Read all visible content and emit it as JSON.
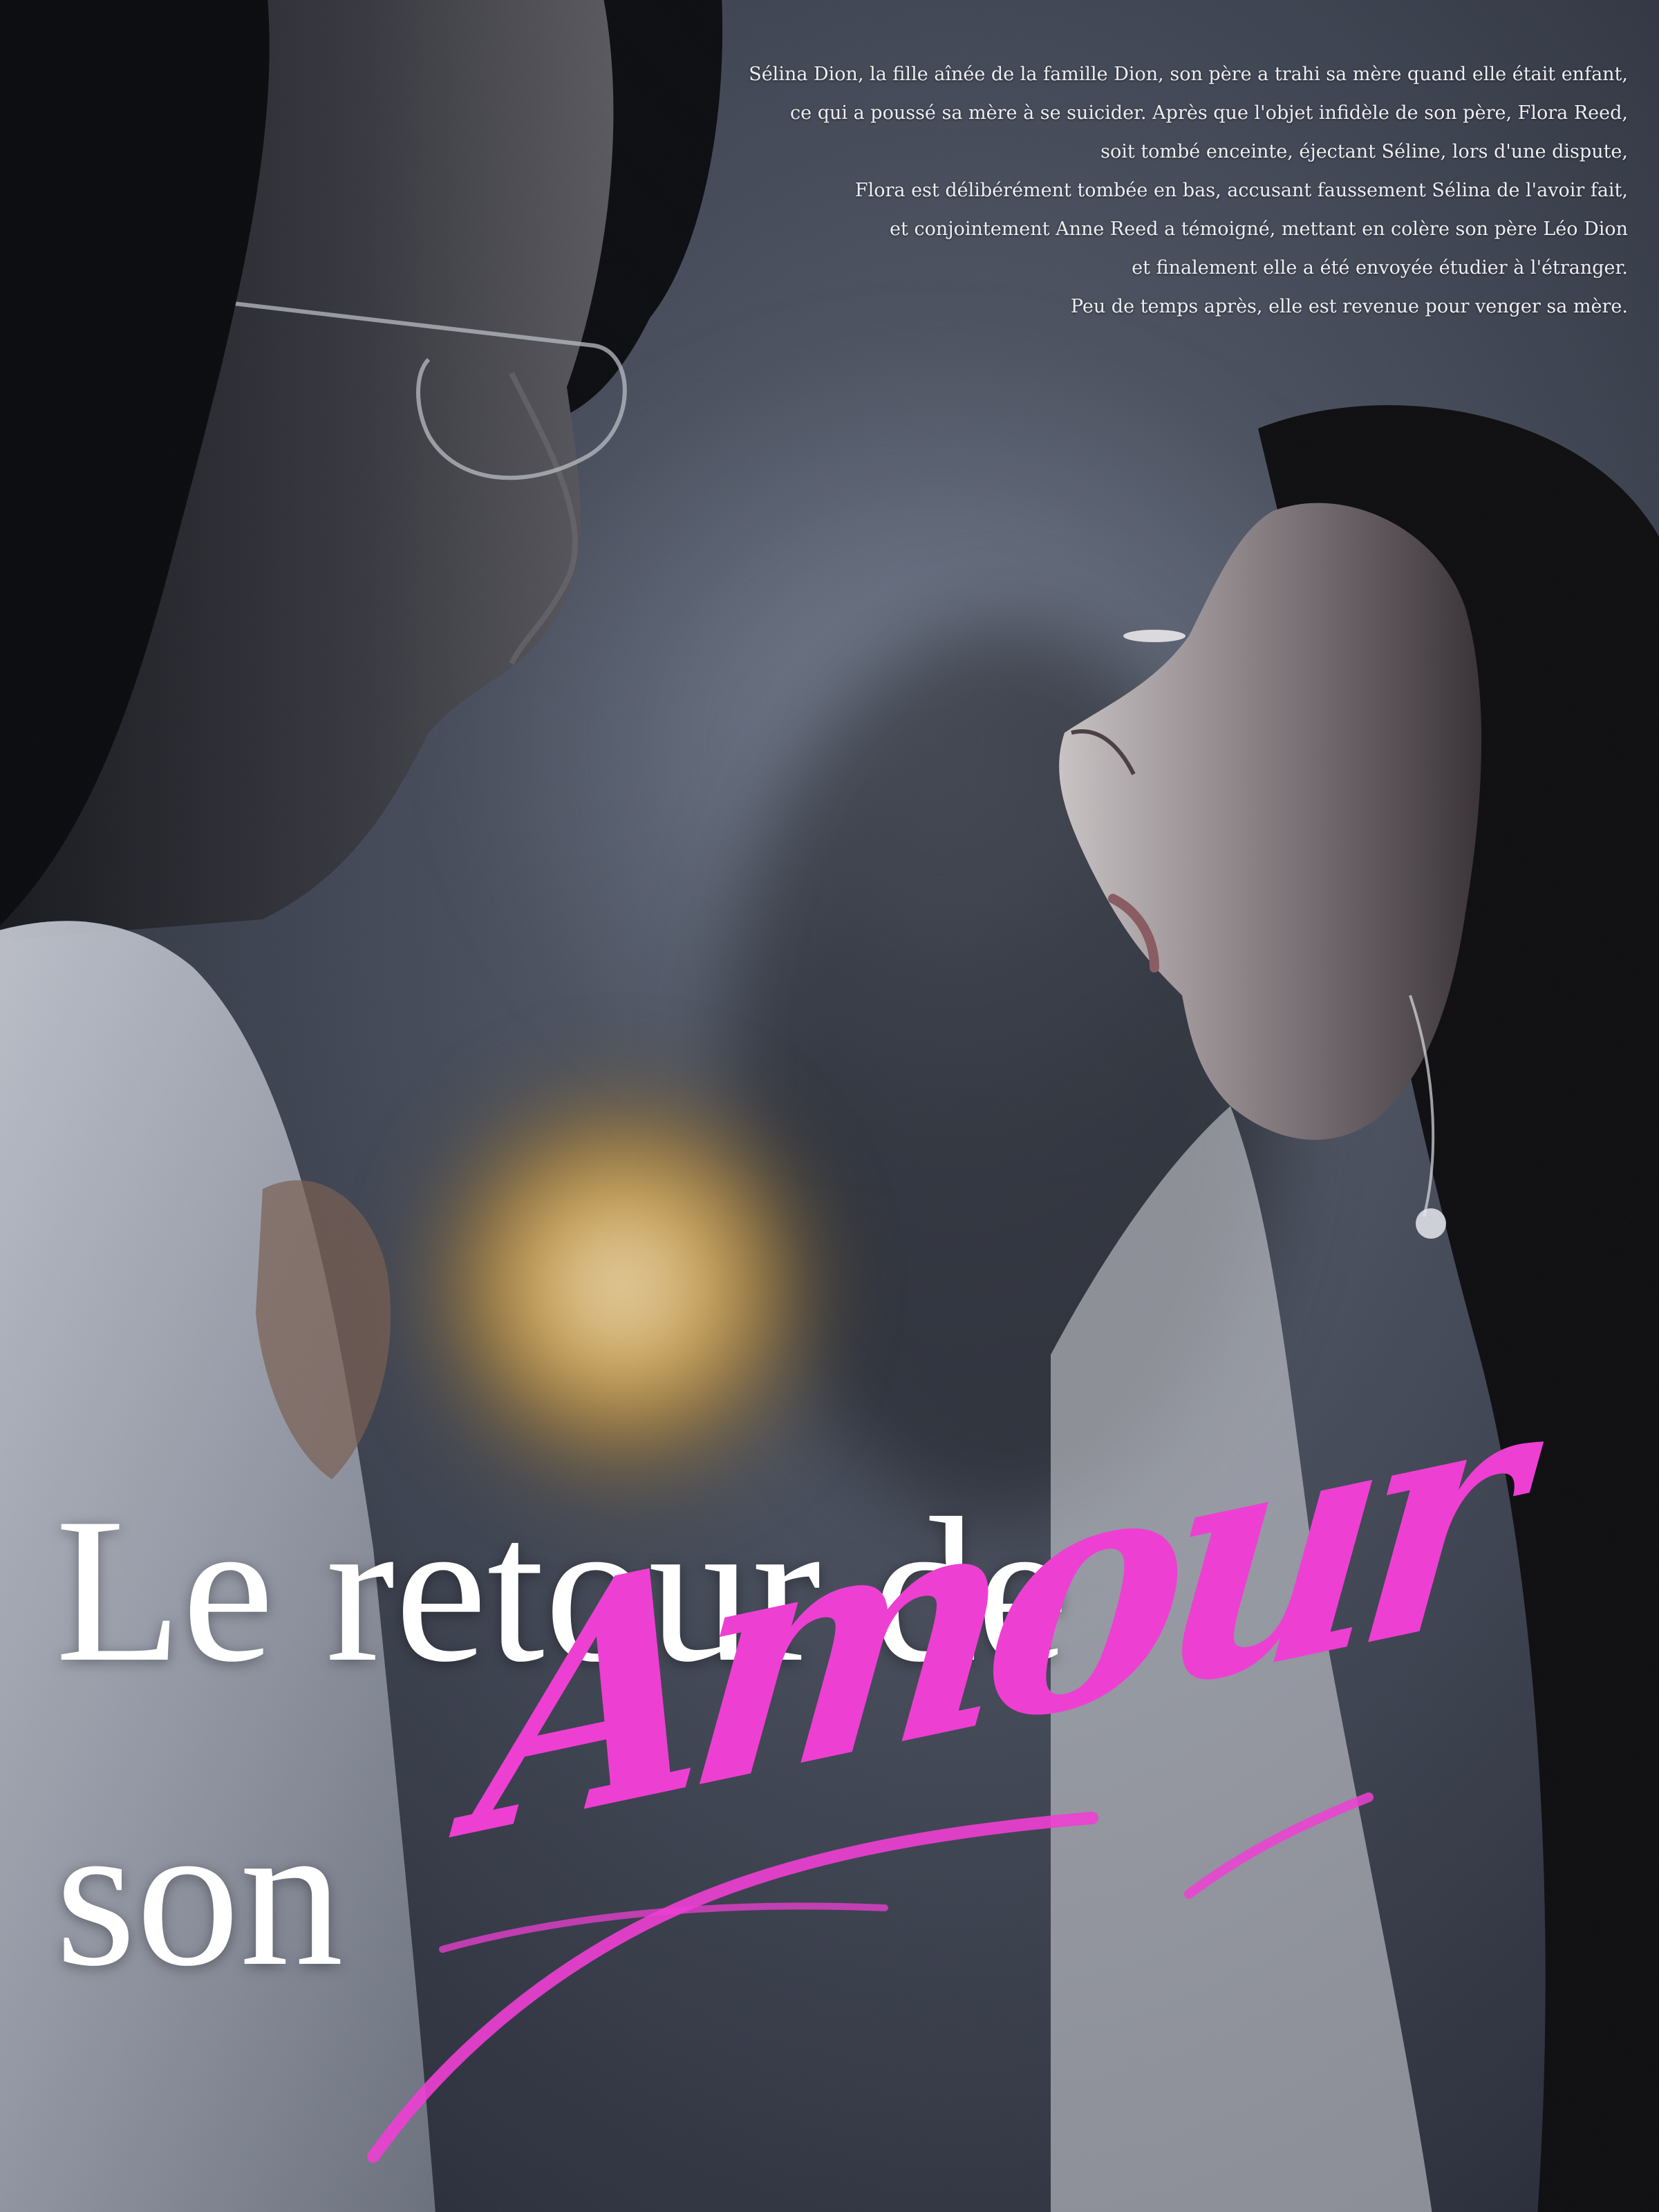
{
  "poster": {
    "synopsis_lines": [
      "Sélina Dion, la fille aînée de la famille Dion, son père a trahi sa mère quand elle était enfant,",
      "ce qui a poussé sa mère à se suicider. Après que l'objet infidèle de son père,  Flora Reed,",
      "soit tombé enceinte, éjectant Séline, lors d'une dispute,",
      "Flora est délibérément tombée en bas, accusant faussement Sélina de l'avoir fait,",
      "et conjointement Anne Reed a témoigné, mettant en colère son père Léo Dion",
      "et finalement elle a été envoyée étudier à l'étranger.",
      "Peu de temps après, elle est revenue pour venger sa mère."
    ],
    "title": {
      "line1": "Le retour de",
      "line2": "son",
      "script": "Amour"
    },
    "colors": {
      "script_accent": "#ee3fd3",
      "title_text": "#ffffff",
      "background": "#4a505e"
    }
  }
}
